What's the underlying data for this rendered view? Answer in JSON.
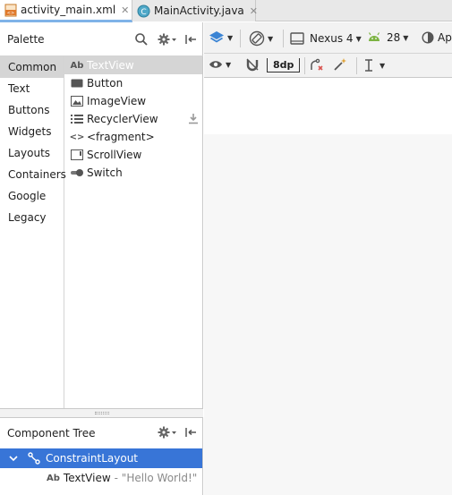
{
  "tabs": [
    {
      "label": "activity_main.xml",
      "icon": "xml-file-icon",
      "active": true
    },
    {
      "label": "MainActivity.java",
      "icon": "java-class-icon",
      "active": false
    }
  ],
  "palette": {
    "title": "Palette",
    "categories": [
      "Common",
      "Text",
      "Buttons",
      "Widgets",
      "Layouts",
      "Containers",
      "Google",
      "Legacy"
    ],
    "selected_category": "Common",
    "widgets": [
      {
        "label": "TextView",
        "icon": "textview-icon",
        "icon_text": "Ab"
      },
      {
        "label": "Button",
        "icon": "button-icon"
      },
      {
        "label": "ImageView",
        "icon": "imageview-icon"
      },
      {
        "label": "RecyclerView",
        "icon": "recyclerview-icon"
      },
      {
        "label": "<fragment>",
        "icon": "fragment-icon",
        "icon_text": "<>"
      },
      {
        "label": "ScrollView",
        "icon": "scrollview-icon"
      },
      {
        "label": "Switch",
        "icon": "switch-icon"
      }
    ]
  },
  "toolbar1": {
    "device": "Nexus 4",
    "api": "28",
    "theme": "Ap"
  },
  "toolbar2": {
    "margin": "8dp"
  },
  "component_tree": {
    "title": "Component Tree",
    "nodes": [
      {
        "label": "ConstraintLayout",
        "icon": "constraint-layout-icon"
      },
      {
        "label": "TextView",
        "icon_text": "Ab",
        "detail": "- \"Hello World!\""
      }
    ]
  },
  "colors": {
    "selection": "#3875d7",
    "tab_underline": "#7fb3e8",
    "android_green": "#7cb342",
    "layers_blue": "#3b84d4"
  }
}
